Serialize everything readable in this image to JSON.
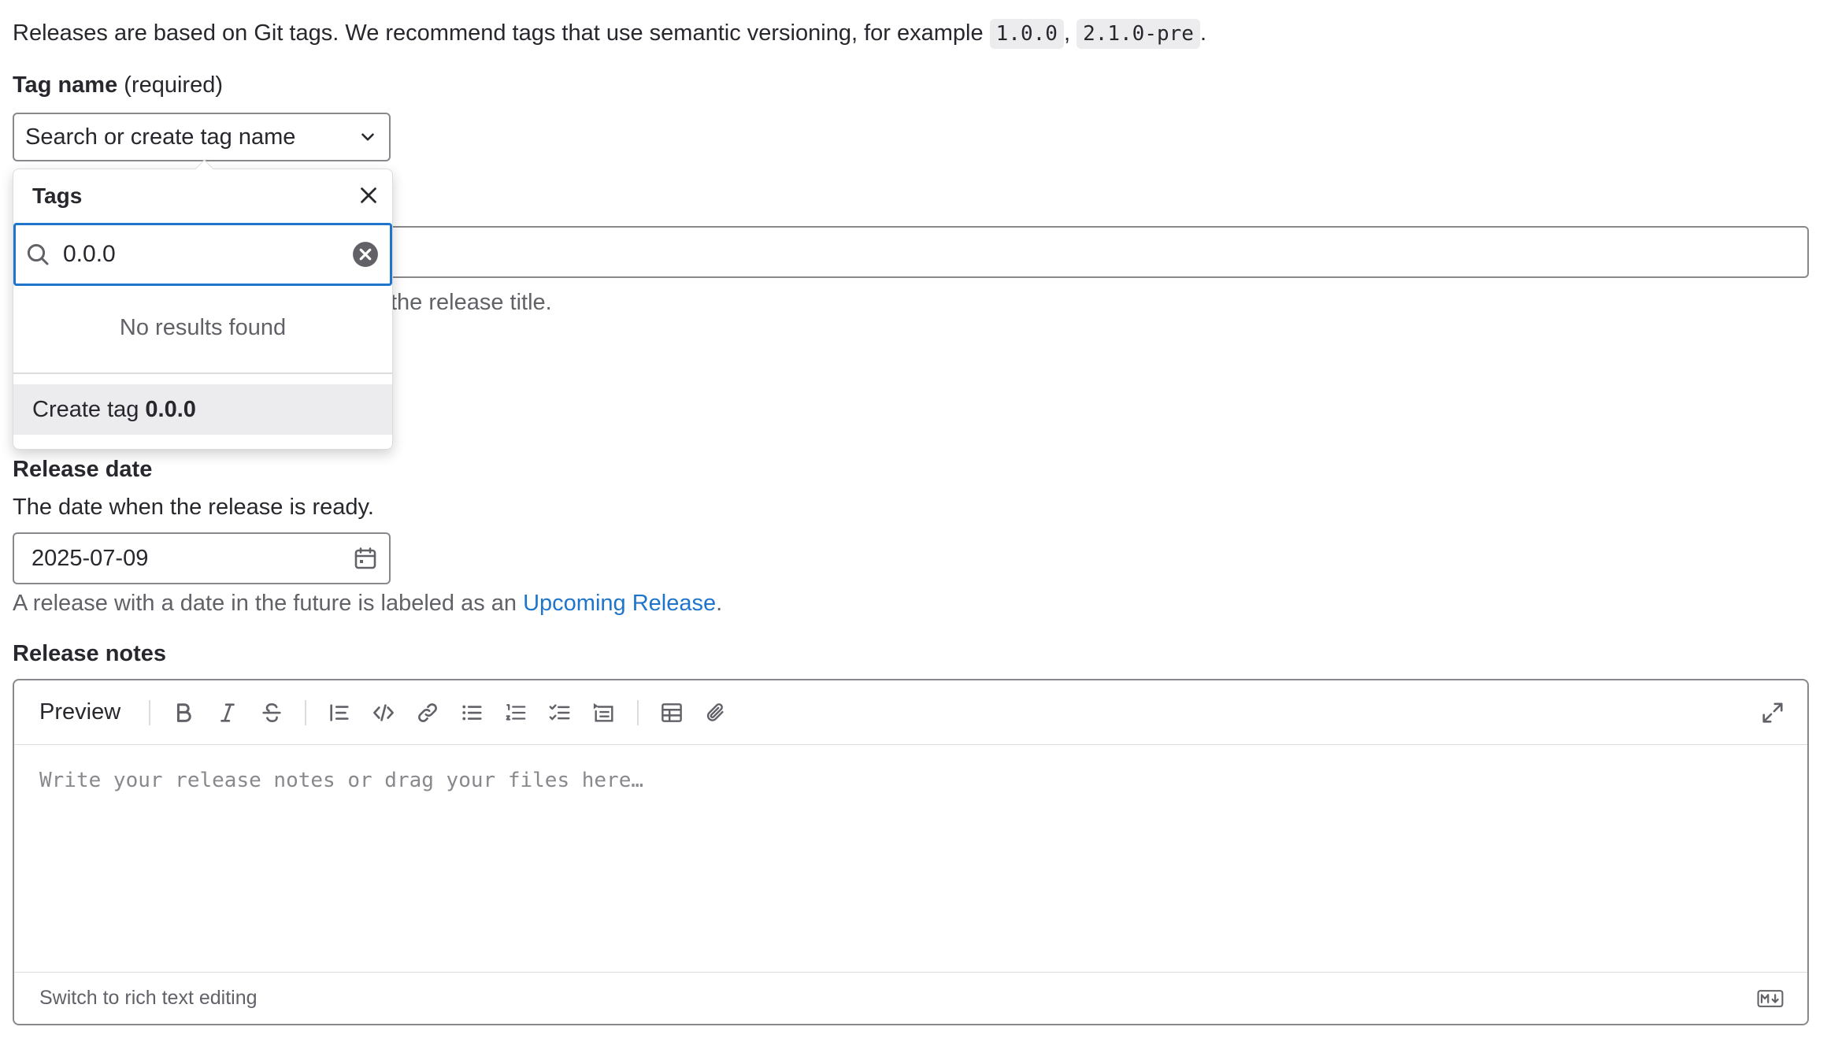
{
  "intro": {
    "text": "Releases are based on Git tags. We recommend tags that use semantic versioning, for example",
    "example1": "1.0.0",
    "sep": ",",
    "example2": "2.1.0-pre",
    "end": "."
  },
  "tag_name": {
    "label": "Tag name",
    "required": "(required)",
    "placeholder": "Search or create tag name"
  },
  "dropdown": {
    "title": "Tags",
    "search_value": "0.0.0",
    "empty_text": "No results found",
    "create_prefix": "Create tag",
    "create_value": "0.0.0"
  },
  "release_title": {
    "help_visible": "the release title."
  },
  "release_date": {
    "label": "Release date",
    "description": "The date when the release is ready.",
    "value": "2025-07-09",
    "help_prefix": "A release with a date in the future is labeled as an",
    "help_link": "Upcoming Release",
    "help_suffix": "."
  },
  "release_notes": {
    "label": "Release notes",
    "toolbar": {
      "preview": "Preview",
      "buttons": [
        "bold-icon",
        "italic-icon",
        "strikethrough-icon",
        "quote-icon",
        "code-icon",
        "link-icon",
        "bullet-list-icon",
        "numbered-list-icon",
        "task-list-icon",
        "collapsible-icon",
        "table-icon",
        "attach-icon",
        "maximize-icon"
      ]
    },
    "placeholder": "Write your release notes or drag your files here…",
    "switch_text": "Switch to rich text editing"
  },
  "colors": {
    "focus": "#1f75cb",
    "link": "#1f75cb",
    "border": "#89888d",
    "muted": "#626168"
  }
}
